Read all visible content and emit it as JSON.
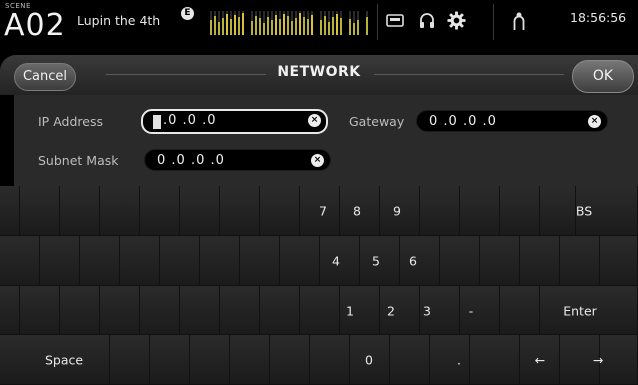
{
  "status_bar": {
    "scene_tag": "SCENE",
    "scene_number": "A02",
    "scene_name": "Lupin the 4th",
    "scene_badge": "E",
    "clock": "18:56:56",
    "icons": [
      "scene-memory-icon",
      "meter-bridge",
      "card-icon",
      "headphones-icon",
      "setup-gear-icon",
      "user-icon"
    ]
  },
  "dialog": {
    "title": "NETWORK",
    "cancel_label": "Cancel",
    "ok_label": "OK"
  },
  "form": {
    "ip_address": {
      "label": "IP Address",
      "value": ".0 .0 .0",
      "focused": true
    },
    "gateway": {
      "label": "Gateway",
      "value": "0 .0 .0 .0"
    },
    "subnet_mask": {
      "label": "Subnet Mask",
      "value": "0 .0 .0 .0"
    },
    "clear_glyph": "×"
  },
  "keypad": {
    "row1": {
      "seven": "7",
      "eight": "8",
      "nine": "9",
      "bs": "BS"
    },
    "row2": {
      "four": "4",
      "five": "5",
      "six": "6"
    },
    "row3": {
      "one": "1",
      "two": "2",
      "three": "3",
      "minus": "-",
      "enter": "Enter"
    },
    "row4": {
      "space": "Space",
      "zero": "0",
      "dot": ".",
      "left": "←",
      "right": "→"
    }
  }
}
